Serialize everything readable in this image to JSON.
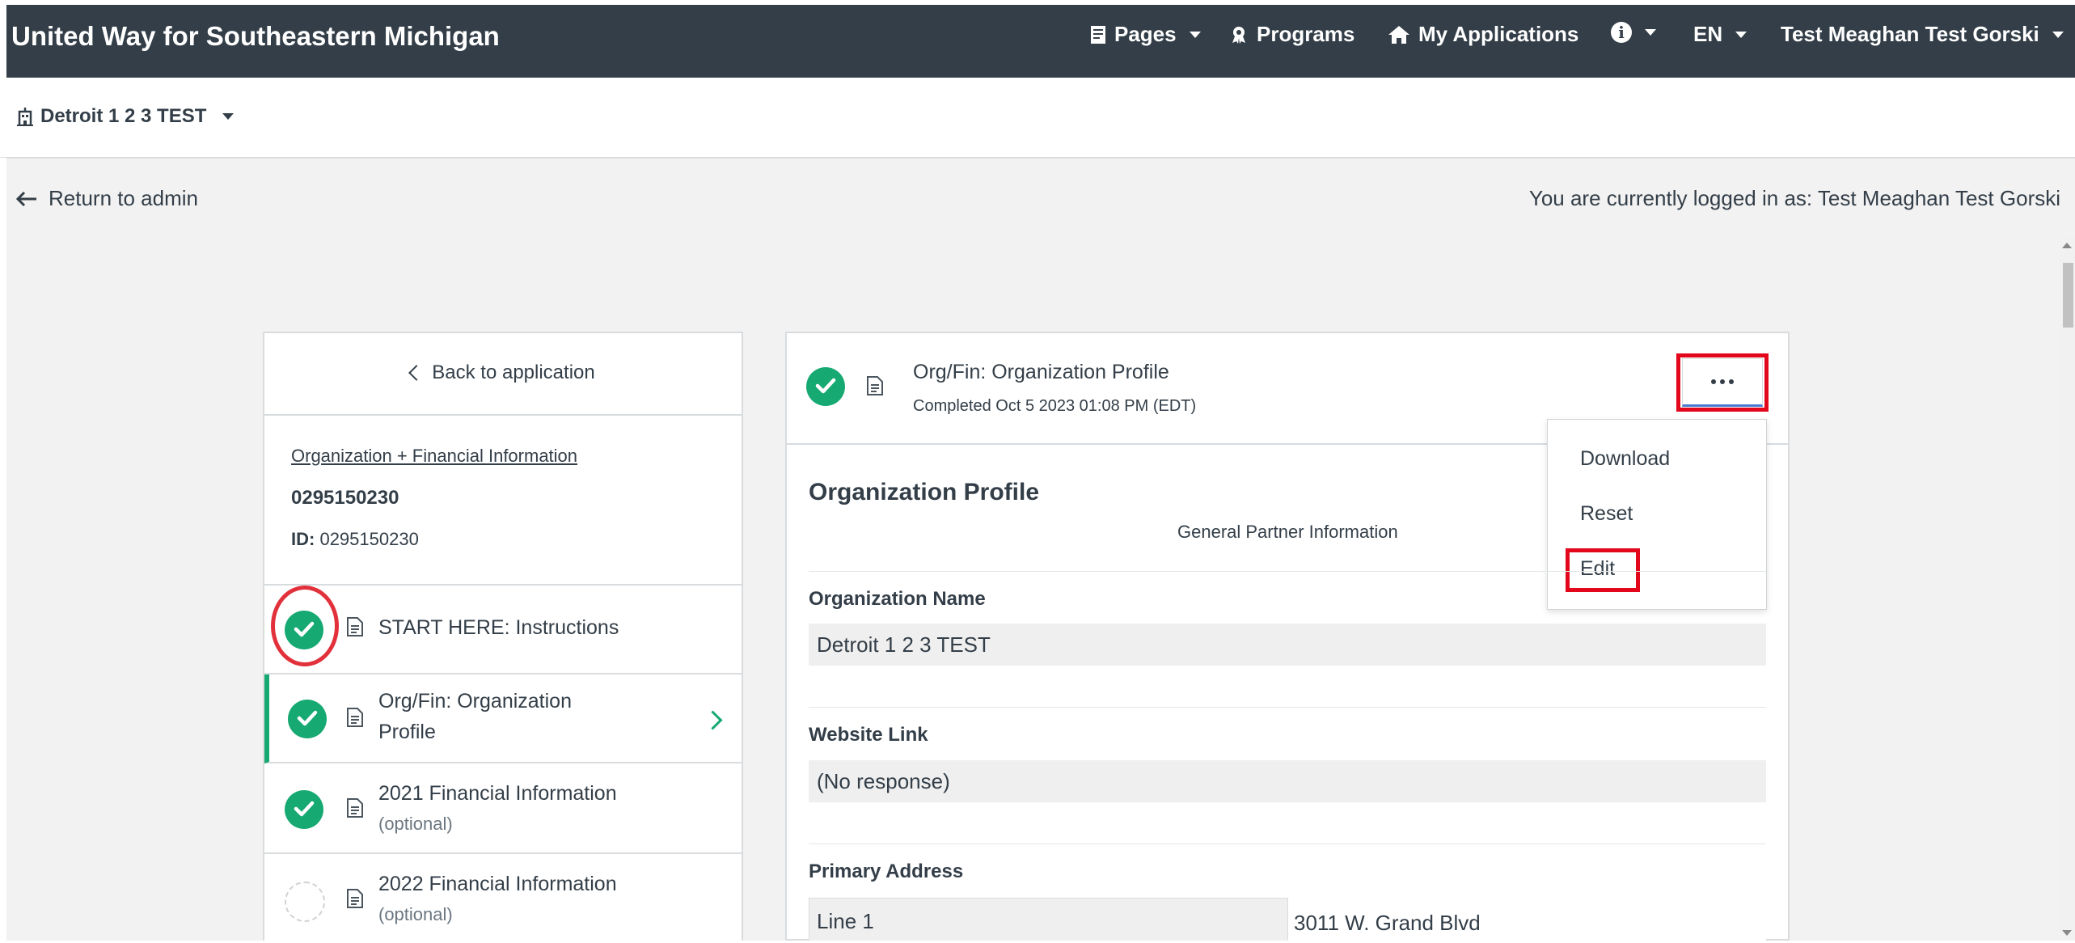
{
  "navbar": {
    "brand": "United Way for Southeastern Michigan",
    "pages_label": "Pages",
    "programs_label": "Programs",
    "my_applications_label": "My Applications",
    "info_glyph": "i",
    "language_label": "EN",
    "user_label": "Test Meaghan Test Gorski"
  },
  "org_bar": {
    "org_name": "Detroit 1 2 3 TEST"
  },
  "admin_bar": {
    "return_label": "Return to admin",
    "logged_in_text": "You are currently logged in as: Test Meaghan Test Gorski"
  },
  "sidebar": {
    "back_label": "Back to application",
    "category_link": "Organization + Financial Information",
    "application_number": "0295150230",
    "id_label": "ID:",
    "id_value": "0295150230",
    "steps": [
      {
        "title": "START HERE: Instructions",
        "subtitle": "",
        "status": "complete"
      },
      {
        "title_line1": "Org/Fin: Organization",
        "title_line2": "Profile",
        "status": "complete",
        "active": true
      },
      {
        "title": "2021 Financial Information",
        "subtitle": "(optional)",
        "status": "complete"
      },
      {
        "title": "2022 Financial Information",
        "subtitle": "(optional)",
        "status": "incomplete"
      }
    ]
  },
  "form": {
    "title": "Org/Fin: Organization Profile",
    "completed_text": "Completed Oct 5 2023 01:08 PM (EDT)",
    "more_menu": {
      "items": [
        "Download",
        "Reset",
        "Edit"
      ]
    },
    "section_title": "Organization Profile",
    "section_subtitle": "General Partner Information",
    "fields": {
      "org_name_label": "Organization Name",
      "org_name_value": "Detroit 1 2 3 TEST",
      "website_label": "Website Link",
      "website_value": "(No response)",
      "address_label": "Primary Address",
      "address_line1_label": "Line 1",
      "address_line1_value": "3011 W. Grand Blvd"
    }
  },
  "colors": {
    "navbar_bg": "#333e48",
    "success_green": "#16a972",
    "annotation_red": "#e2071b",
    "page_bg": "#f2f2f2"
  },
  "icons": [
    "pages-icon",
    "programs-icon",
    "home-icon",
    "info-icon",
    "building-icon",
    "arrow-left-icon",
    "chevron-left-icon",
    "check-circle-icon",
    "document-icon",
    "chevron-right-icon",
    "more-dots-icon"
  ]
}
